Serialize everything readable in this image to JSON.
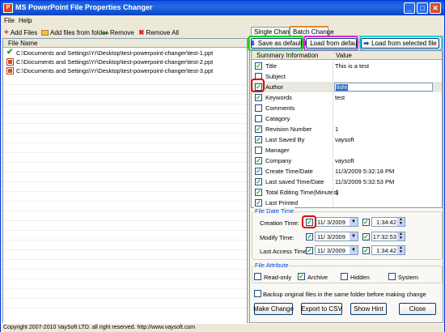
{
  "window": {
    "title": "MS PowerPoint File Properties Changer",
    "minimize": "_",
    "maximize": "□",
    "close": "✕"
  },
  "menu": {
    "file": "File",
    "help": "Help"
  },
  "toolbar": {
    "add_files": "Add Files",
    "add_folder": "Add files from folder",
    "remove": "Remove",
    "remove_all": "Remove All"
  },
  "file_list": {
    "header": "File Name",
    "files": [
      {
        "path": "C:\\Documents and Settings\\Yr\\Desktop\\test-powerpoint-changer\\test-1.ppt",
        "icon": "check-icon"
      },
      {
        "path": "C:\\Documents and Settings\\Yr\\Desktop\\test-powerpoint-changer\\test-2.ppt",
        "icon": "ppt-file-icon"
      },
      {
        "path": "C:\\Documents and Settings\\Yr\\Desktop\\test-powerpoint-changer\\test-3.ppt",
        "icon": "ppt-file-icon"
      }
    ]
  },
  "tabs": {
    "single": "Single Change",
    "batch": "Batch Change"
  },
  "actions": {
    "save_default": "Save as default",
    "load_default": "Load from default",
    "load_selected": "Load from selected file"
  },
  "grid": {
    "col_info": "Summary Information",
    "col_value": "Value",
    "rows": [
      {
        "name": "Title",
        "value": "This is a test",
        "checked": true
      },
      {
        "name": "Subject",
        "value": "",
        "checked": false
      },
      {
        "name": "Author",
        "value": "lishi",
        "checked": true
      },
      {
        "name": "Keywords",
        "value": "test",
        "checked": true
      },
      {
        "name": "Comments",
        "value": "",
        "checked": false
      },
      {
        "name": "Catagory",
        "value": "",
        "checked": false
      },
      {
        "name": "Revision Number",
        "value": "1",
        "checked": true
      },
      {
        "name": "Last Saved By",
        "value": "vaysoft",
        "checked": true
      },
      {
        "name": "Manager",
        "value": "",
        "checked": false
      },
      {
        "name": "Company",
        "value": "vaysoft",
        "checked": true
      },
      {
        "name": "Create Time/Date",
        "value": "11/3/2009 5:32:18 PM",
        "checked": true
      },
      {
        "name": "Last saved Time/Date",
        "value": "11/3/2009 5:32:53 PM",
        "checked": true
      },
      {
        "name": "Total Editing Time(Minutes)",
        "value": "1",
        "checked": true
      },
      {
        "name": "Last Printed",
        "value": "",
        "checked": true
      }
    ]
  },
  "date_time": {
    "legend": "File Date Time",
    "creation_label": "Creation Time:",
    "creation_date": "11/ 3/2009",
    "creation_time": "1:34:42",
    "modify_label": "Modify Time:",
    "modify_date": "11/ 3/2009",
    "modify_time": "17:32:53",
    "access_label": "Last Access Time:",
    "access_date": "11/ 3/2009",
    "access_time": "1:34:42"
  },
  "attributes": {
    "legend": "File Attribute",
    "readonly": "Read-only",
    "archive": "Archive",
    "hidden": "Hidden",
    "system": "System"
  },
  "backup": "Backup original files in the same folder before making change",
  "buttons": {
    "make_change": "Make Change",
    "export_csv": "Export to CSV",
    "show_hint": "Show Hint",
    "close": "Close"
  },
  "status": "Copyright 2007-2010 VaySoft LTD. all right reserved. http://www.vaysoft.com",
  "colors": {
    "highlight_green": "#19d119",
    "highlight_magenta": "#e020e0",
    "highlight_cyan": "#18d4e0",
    "highlight_red": "#e00000",
    "accent_blue": "#0a5ad8"
  }
}
